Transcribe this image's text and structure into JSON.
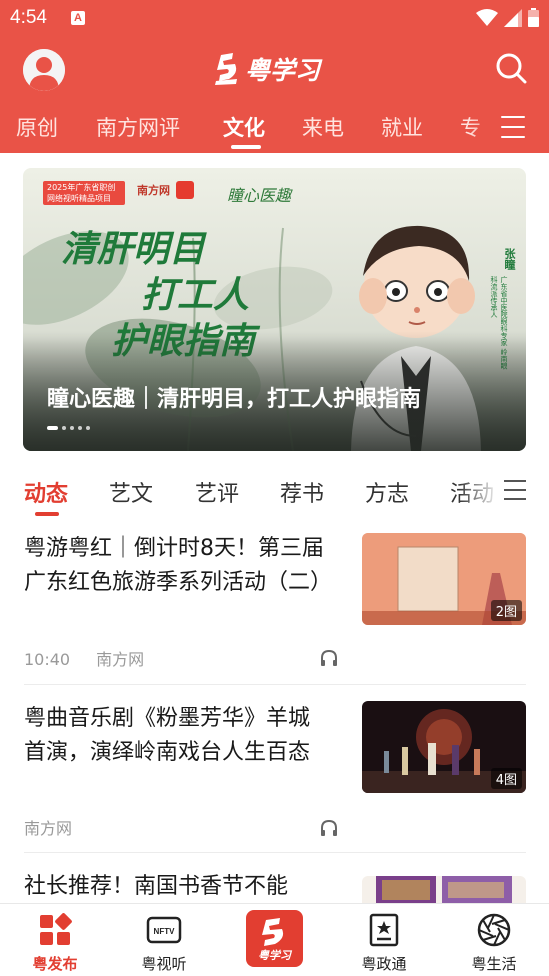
{
  "status_bar": {
    "time": "4:54",
    "notification_letter": "A"
  },
  "header": {
    "logo_text": "粤学习"
  },
  "channels": {
    "tabs": [
      "原创",
      "南方网评",
      "文化",
      "来电",
      "就业",
      "专"
    ],
    "active": "文化"
  },
  "banner": {
    "badge": "2025年广东省职创网络视听精品项目",
    "partner_logos": [
      "南方网",
      "粤学习"
    ],
    "brand": "瞳心医趣",
    "calligraphy": [
      "清肝明目",
      "打工人",
      "护眼指南"
    ],
    "side_name": "张瞳",
    "side_desc": "广东省中医院眼科专家 岭南眼科流派传承人",
    "title": "瞳心医趣｜清肝明目，打工人护眼指南",
    "slide_count": 5,
    "active_slide": 1
  },
  "sub_tabs": {
    "tabs": [
      "动态",
      "艺文",
      "艺评",
      "荐书",
      "方志",
      "活动"
    ],
    "active": "动态"
  },
  "articles": [
    {
      "title": "粤游粤红｜倒计时8天！第三届广东红色旅游季系列活动（二）",
      "time": "10:40",
      "source": "南方网",
      "thumb_count": "2图",
      "has_audio": true
    },
    {
      "title": "粤曲音乐剧《粉墨芳华》羊城首演，演绎岭南戏台人生百态",
      "time": "",
      "source": "南方网",
      "thumb_count": "4图",
      "has_audio": true
    },
    {
      "title": "社长推荐！南国书香节不能",
      "time": "",
      "source": "",
      "thumb_count": "",
      "has_audio": false
    }
  ],
  "bottom_nav": {
    "items": [
      {
        "label": "粤发布",
        "icon": "grid-apps-icon",
        "active": true
      },
      {
        "label": "粤视听",
        "icon": "tv-icon",
        "active": false
      },
      {
        "label": "粤学习",
        "icon": "yue-xuexi-logo-icon",
        "active": false
      },
      {
        "label": "粤政通",
        "icon": "badge-star-icon",
        "active": false
      },
      {
        "label": "粤生活",
        "icon": "camera-aperture-icon",
        "active": false
      }
    ]
  },
  "colors": {
    "brand_red": "#e95347",
    "active_red": "#e23e31",
    "banner_green": "#1f7a3a"
  }
}
